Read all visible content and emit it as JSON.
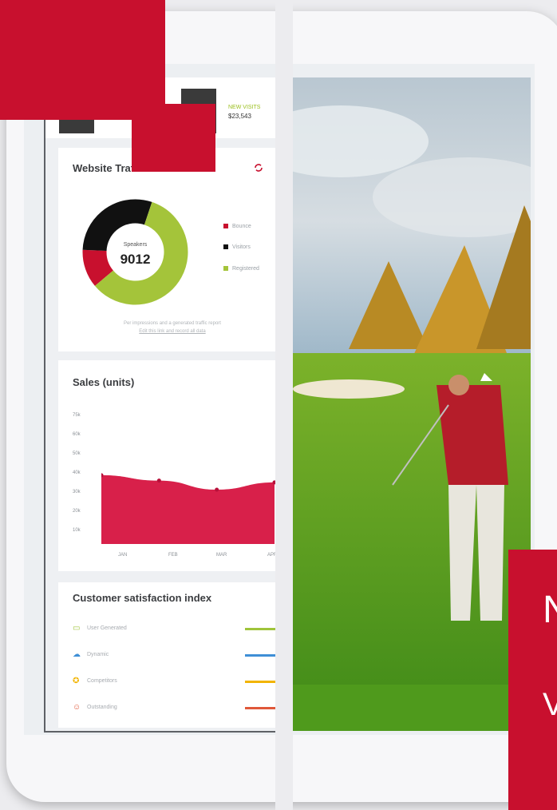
{
  "topstats": {
    "label": "NEW VISITS",
    "value": "$23,543"
  },
  "traffic": {
    "title": "Website Traffic",
    "refresh_icon": "refresh-icon",
    "center_label": "Speakers",
    "center_value": "9012",
    "legend": [
      {
        "label": "Bounce",
        "color": "#c8102e"
      },
      {
        "label": "Visitors",
        "color": "#111111"
      },
      {
        "label": "Registered",
        "color": "#a4c43a"
      }
    ],
    "caption_line1": "Per impressions and a generated traffic report",
    "caption_line2": "Edit this link and record all data"
  },
  "sales": {
    "title": "Sales (units)",
    "y_ticks": [
      "75k",
      "60k",
      "50k",
      "40k",
      "30k",
      "20k",
      "10k"
    ],
    "x_ticks": [
      "JAN",
      "FEB",
      "MAR",
      "APR"
    ]
  },
  "csi": {
    "title": "Customer satisfaction index",
    "rows": [
      {
        "label": "User Generated",
        "icon": "monitor-icon",
        "color": "#9fc43a"
      },
      {
        "label": "Dynamic",
        "icon": "cloud-icon",
        "color": "#3f8fd6"
      },
      {
        "label": "Competitors",
        "icon": "badge-icon",
        "color": "#f2b400"
      },
      {
        "label": "Outstanding",
        "icon": "smile-icon",
        "color": "#e0583a"
      }
    ]
  },
  "overlay": {
    "line1": "N",
    "line2": "V"
  },
  "colors": {
    "brand": "#c8102e",
    "accent_green": "#a4c43a",
    "chart_red": "#d8204a"
  },
  "chart_data": [
    {
      "type": "pie",
      "title": "Website Traffic",
      "categories": [
        "Bounce",
        "Visitors",
        "Registered"
      ],
      "values": [
        10,
        25,
        50
      ]
    },
    {
      "type": "area",
      "title": "Sales (units)",
      "categories": [
        "JAN",
        "FEB",
        "MAR",
        "APR"
      ],
      "values": [
        38000,
        35000,
        30000,
        34000
      ]
    }
  ]
}
